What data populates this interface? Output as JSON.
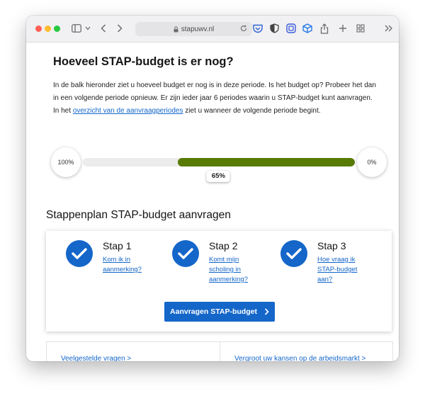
{
  "browser": {
    "url": "stapuwv.nl"
  },
  "budget": {
    "title": "Hoeveel STAP-budget is er nog?",
    "intro_before_link": "In de balk hieronder ziet u hoeveel budget er nog is in deze periode. Is het budget op? Probeer het dan in een volgende periode opnieuw. Er zijn ieder jaar 6 periodes waarin u STAP-budget kunt aanvragen. In het ",
    "intro_link": "overzicht van de aanvraagperiodes",
    "intro_after_link": " ziet u wanneer de volgende periode begint.",
    "left_label": "100%",
    "right_label": "0%",
    "remaining_label": "65%",
    "remaining_fraction": 0.65,
    "bar_color": "#577b05"
  },
  "steps": {
    "title": "Stappenplan STAP-budget aanvragen",
    "items": [
      {
        "name": "Stap 1",
        "link": "Kom ik in aanmerking?"
      },
      {
        "name": "Stap 2",
        "link": "Komt mijn scholing in aanmerking?"
      },
      {
        "name": "Stap 3",
        "link": "Hoe vraag ik STAP-budget aan?"
      }
    ],
    "cta_label": "Aanvragen STAP-budget",
    "accent_color": "#1466c9"
  },
  "footer_links": {
    "faq": "Veelgestelde vragen >",
    "career": "Vergroot uw kansen op de arbeidsmarkt >"
  }
}
